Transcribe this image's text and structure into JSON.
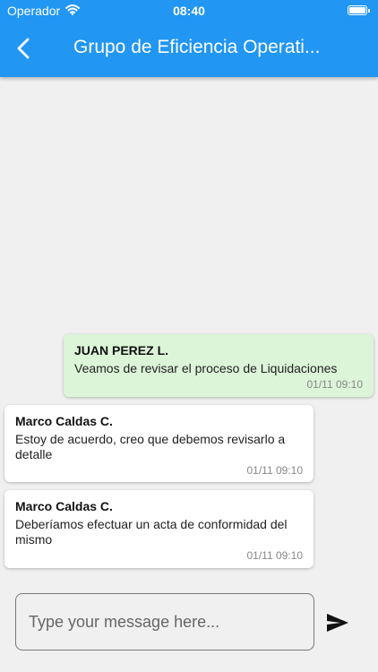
{
  "status_bar": {
    "carrier": "Operador",
    "time": "08:40",
    "wifi_icon": "wifi-icon",
    "battery_icon": "battery-icon"
  },
  "header": {
    "back_icon": "chevron-left-icon",
    "title": "Grupo de Eficiencia Operati..."
  },
  "messages": [
    {
      "sender": "JUAN PEREZ L.",
      "text": "Veamos de revisar el proceso de Liquidaciones",
      "time": "01/11 09:10",
      "own": true
    },
    {
      "sender": "Marco Caldas C.",
      "text": "Estoy de acuerdo, creo que debemos revisarlo a detalle",
      "time": "01/11 09:10",
      "own": false
    },
    {
      "sender": "Marco Caldas C.",
      "text": "Deberíamos efectuar un acta de conformidad del mismo",
      "time": "01/11 09:10",
      "own": false
    }
  ],
  "composer": {
    "placeholder": "Type your message here...",
    "value": "",
    "send_icon": "send-icon"
  },
  "colors": {
    "header": "#2196f3",
    "background": "#f0f0f0",
    "own_bubble": "#dcf5d8",
    "other_bubble": "#ffffff"
  }
}
